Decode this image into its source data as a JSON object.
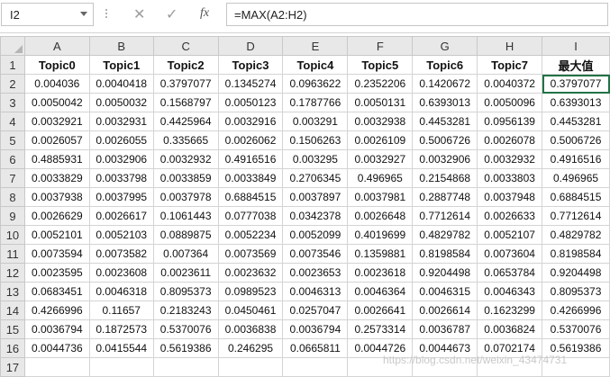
{
  "formula_bar": {
    "name_box": "I2",
    "cancel_icon": "✕",
    "enter_icon": "✓",
    "fx_label": "fx",
    "formula": "=MAX(A2:H2)"
  },
  "columns": [
    "A",
    "B",
    "C",
    "D",
    "E",
    "F",
    "G",
    "H",
    "I"
  ],
  "row_numbers": [
    "1",
    "2",
    "3",
    "4",
    "5",
    "6",
    "7",
    "8",
    "9",
    "10",
    "11",
    "12",
    "13",
    "14",
    "15",
    "16",
    "17"
  ],
  "headers": [
    "Topic0",
    "Topic1",
    "Topic2",
    "Topic3",
    "Topic4",
    "Topic5",
    "Topic6",
    "Topic7",
    "最大值"
  ],
  "rows": [
    [
      "0.004036",
      "0.0040418",
      "0.3797077",
      "0.1345274",
      "0.0963622",
      "0.2352206",
      "0.1420672",
      "0.0040372",
      "0.3797077"
    ],
    [
      "0.0050042",
      "0.0050032",
      "0.1568797",
      "0.0050123",
      "0.1787766",
      "0.0050131",
      "0.6393013",
      "0.0050096",
      "0.6393013"
    ],
    [
      "0.0032921",
      "0.0032931",
      "0.4425964",
      "0.0032916",
      "0.003291",
      "0.0032938",
      "0.4453281",
      "0.0956139",
      "0.4453281"
    ],
    [
      "0.0026057",
      "0.0026055",
      "0.335665",
      "0.0026062",
      "0.1506263",
      "0.0026109",
      "0.5006726",
      "0.0026078",
      "0.5006726"
    ],
    [
      "0.4885931",
      "0.0032906",
      "0.0032932",
      "0.4916516",
      "0.003295",
      "0.0032927",
      "0.0032906",
      "0.0032932",
      "0.4916516"
    ],
    [
      "0.0033829",
      "0.0033798",
      "0.0033859",
      "0.0033849",
      "0.2706345",
      "0.496965",
      "0.2154868",
      "0.0033803",
      "0.496965"
    ],
    [
      "0.0037938",
      "0.0037995",
      "0.0037978",
      "0.6884515",
      "0.0037897",
      "0.0037981",
      "0.2887748",
      "0.0037948",
      "0.6884515"
    ],
    [
      "0.0026629",
      "0.0026617",
      "0.1061443",
      "0.0777038",
      "0.0342378",
      "0.0026648",
      "0.7712614",
      "0.0026633",
      "0.7712614"
    ],
    [
      "0.0052101",
      "0.0052103",
      "0.0889875",
      "0.0052234",
      "0.0052099",
      "0.4019699",
      "0.4829782",
      "0.0052107",
      "0.4829782"
    ],
    [
      "0.0073594",
      "0.0073582",
      "0.007364",
      "0.0073569",
      "0.0073546",
      "0.1359881",
      "0.8198584",
      "0.0073604",
      "0.8198584"
    ],
    [
      "0.0023595",
      "0.0023608",
      "0.0023611",
      "0.0023632",
      "0.0023653",
      "0.0023618",
      "0.9204498",
      "0.0653784",
      "0.9204498"
    ],
    [
      "0.0683451",
      "0.0046318",
      "0.8095373",
      "0.0989523",
      "0.0046313",
      "0.0046364",
      "0.0046315",
      "0.0046343",
      "0.8095373"
    ],
    [
      "0.4266996",
      "0.11657",
      "0.2183243",
      "0.0450461",
      "0.0257047",
      "0.0026641",
      "0.0026614",
      "0.1623299",
      "0.4266996"
    ],
    [
      "0.0036794",
      "0.1872573",
      "0.5370076",
      "0.0036838",
      "0.0036794",
      "0.2573314",
      "0.0036787",
      "0.0036824",
      "0.5370076"
    ],
    [
      "0.0044736",
      "0.0415544",
      "0.5619386",
      "0.246295",
      "0.0665811",
      "0.0044726",
      "0.0044673",
      "0.0702174",
      "0.5619386"
    ],
    [
      "",
      "",
      "",
      "",
      "",
      "",
      "",
      "",
      ""
    ]
  ],
  "watermark": "https://blog.csdn.net/weixin_43474731"
}
